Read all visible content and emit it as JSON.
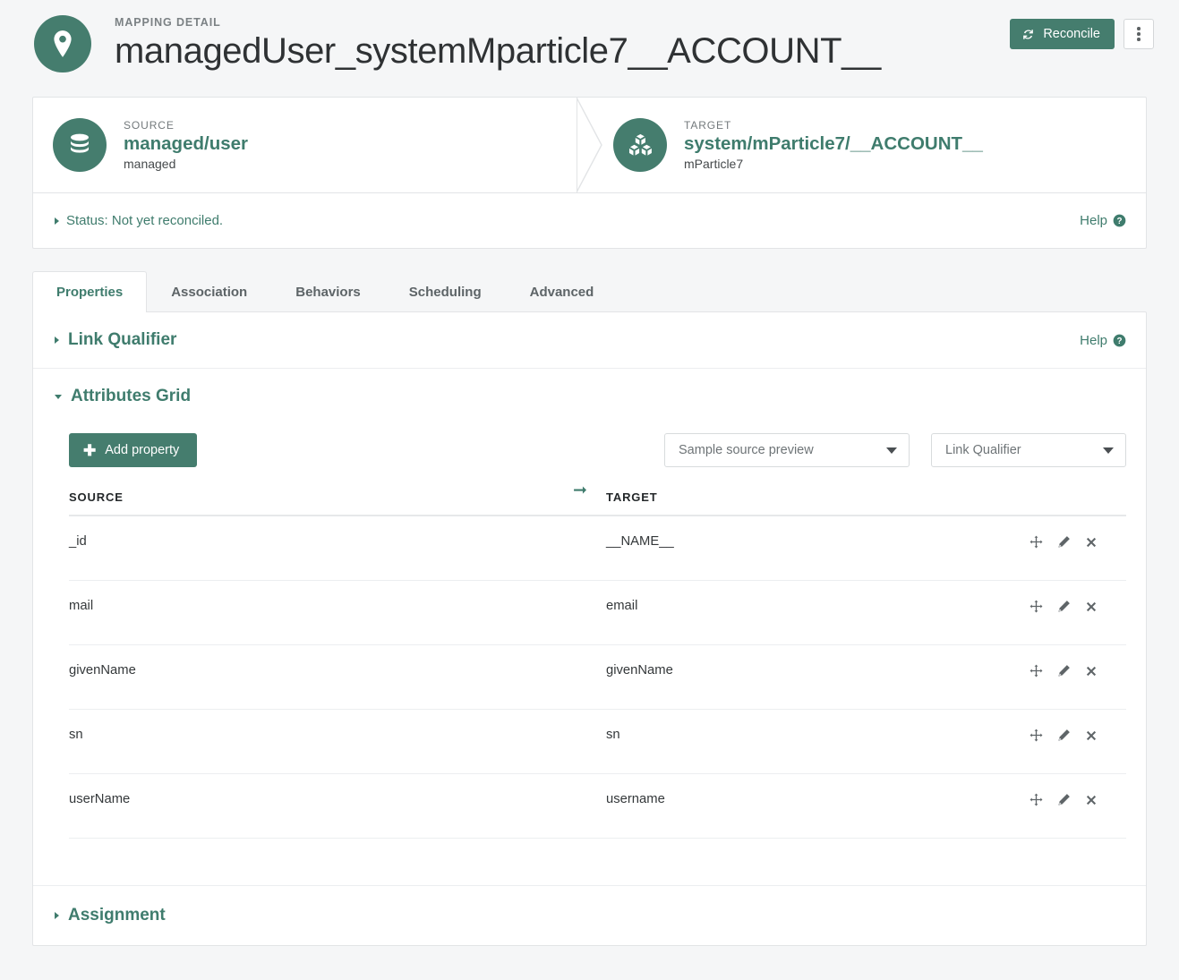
{
  "header": {
    "eyebrow": "MAPPING DETAIL",
    "title": "managedUser_systemMparticle7__ACCOUNT__",
    "avatar_icon": "map-pin-icon",
    "reconcile_label": "Reconcile",
    "reconcile_icon": "refresh-icon",
    "kebab_icon": "kebab-menu-icon"
  },
  "mapping": {
    "source": {
      "label": "SOURCE",
      "name": "managed/user",
      "sub": "managed",
      "icon": "database-icon"
    },
    "target": {
      "label": "TARGET",
      "name": "system/mParticle7/__ACCOUNT__",
      "sub": "mParticle7",
      "icon": "cubes-icon"
    },
    "arrow_icon": "arrow-right-icon",
    "status_text": "Status: Not yet reconciled.",
    "help_label": "Help",
    "help_icon": "question-circle-icon"
  },
  "tabs": [
    {
      "label": "Properties",
      "active": true
    },
    {
      "label": "Association",
      "active": false
    },
    {
      "label": "Behaviors",
      "active": false
    },
    {
      "label": "Scheduling",
      "active": false
    },
    {
      "label": "Advanced",
      "active": false
    }
  ],
  "sections": {
    "link_qualifier": {
      "title": "Link Qualifier",
      "expanded": false,
      "help_label": "Help",
      "help_icon": "question-circle-icon"
    },
    "attributes_grid": {
      "title": "Attributes Grid",
      "expanded": true,
      "add_property_label": "Add property",
      "add_property_icon": "plus-icon",
      "sample_source_preview": {
        "value": "Sample source preview",
        "caret_icon": "chevron-down-icon"
      },
      "link_qualifier_select": {
        "value": "Link Qualifier",
        "caret_icon": "chevron-down-icon"
      },
      "columns": {
        "source": "SOURCE",
        "target": "TARGET"
      },
      "rows": [
        {
          "source": "_id",
          "target": "__NAME__"
        },
        {
          "source": "mail",
          "target": "email"
        },
        {
          "source": "givenName",
          "target": "givenName"
        },
        {
          "source": "sn",
          "target": "sn"
        },
        {
          "source": "userName",
          "target": "username"
        }
      ],
      "row_action_icons": {
        "move": "move-arrows-icon",
        "edit": "pencil-icon",
        "delete": "close-x-icon"
      }
    },
    "assignment": {
      "title": "Assignment",
      "expanded": false
    }
  },
  "colors": {
    "accent": "#457d6e",
    "accent_text": "#3f7c6d",
    "page_bg": "#f5f6f7",
    "border": "#e2e4e6",
    "text": "#34383a",
    "muted": "#73797c"
  }
}
